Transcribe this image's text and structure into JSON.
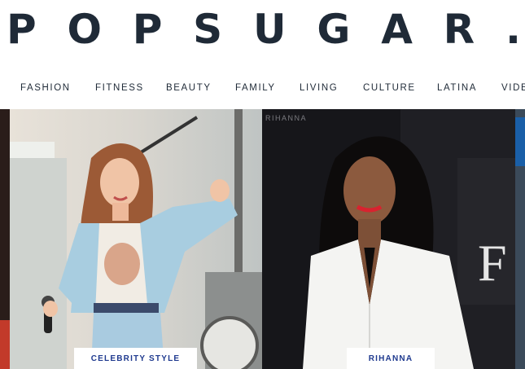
{
  "logo": {
    "letters": [
      "P",
      "O",
      "P",
      "S",
      "U",
      "G",
      "A",
      "R",
      "."
    ]
  },
  "nav": {
    "items": [
      {
        "label": "FASHION"
      },
      {
        "label": "FITNESS"
      },
      {
        "label": "BEAUTY"
      },
      {
        "label": "FAMILY"
      },
      {
        "label": "LIVING"
      },
      {
        "label": "CULTURE"
      },
      {
        "label": "LATINA"
      },
      {
        "label": "VIDE"
      }
    ]
  },
  "cards": [
    {
      "label": "CELEBRITY STYLE"
    },
    {
      "label": "RIHANNA"
    }
  ],
  "photo_text": {
    "backdrop_small": "RIHANNA",
    "backdrop_big": "F"
  },
  "colors": {
    "logo": "#1f2a37",
    "nav_text": "#1f2a37",
    "card_label": "#1f3a8f"
  }
}
